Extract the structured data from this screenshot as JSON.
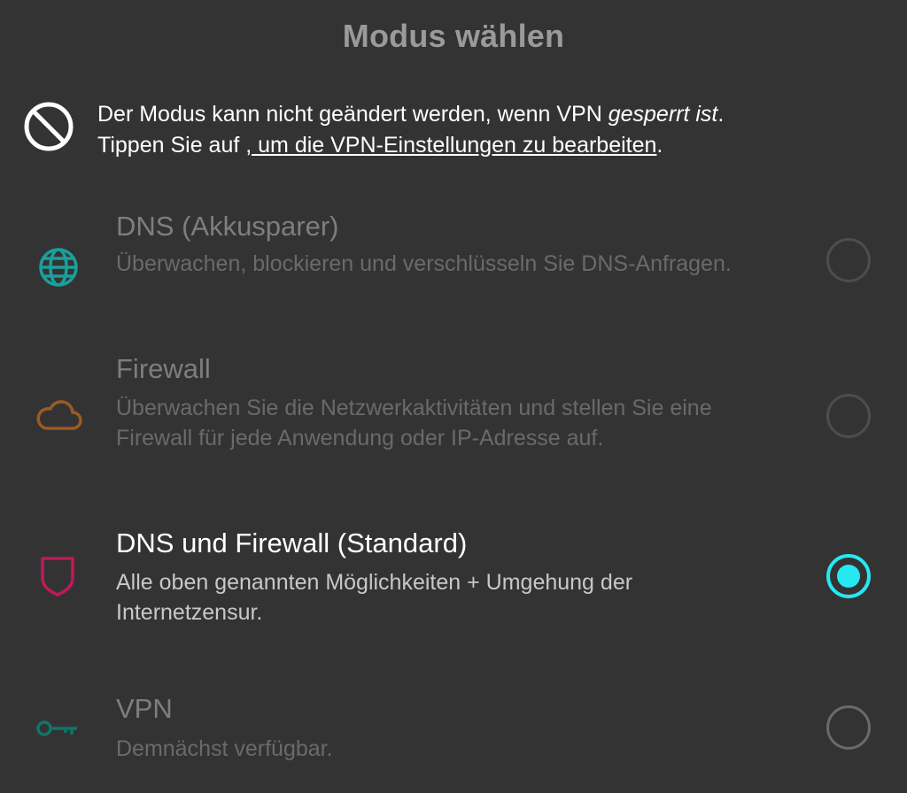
{
  "dialog": {
    "title": "Modus wählen"
  },
  "notice": {
    "icon": "block-icon",
    "text_before": "Der Modus kann nicht geändert werden, wenn VPN ",
    "text_em": "gesperrt ist",
    "text_after_em": ".",
    "line2_before": "Tippen Sie auf ",
    "link": ", um die VPN-Einstellungen zu bearbeiten",
    "line2_after": "."
  },
  "options": [
    {
      "title": "DNS (Akkusparer)",
      "description": "Überwachen, blockieren und verschlüsseln Sie DNS-Anfragen.",
      "icon": "globe-icon",
      "icon_color": "#1b9f9c",
      "selected": false
    },
    {
      "title": "Firewall",
      "description": "Überwachen Sie die Netzwerkaktivitäten und stellen Sie eine Firewall für jede Anwendung oder IP-Adresse auf.",
      "icon": "cloud-icon",
      "icon_color": "#9a5b22",
      "selected": false
    },
    {
      "title": "DNS und Firewall (Standard)",
      "description": "Alle oben genannten Möglichkeiten + Umgehung der Internetzensur.",
      "icon": "shield-icon",
      "icon_color": "#c2185b",
      "selected": true
    },
    {
      "title": "VPN",
      "description": "Demnächst verfügbar.",
      "icon": "key-icon",
      "icon_color": "#11746a",
      "selected": false
    }
  ],
  "colors": {
    "background": "#333333",
    "accent": "#25e8f0"
  }
}
